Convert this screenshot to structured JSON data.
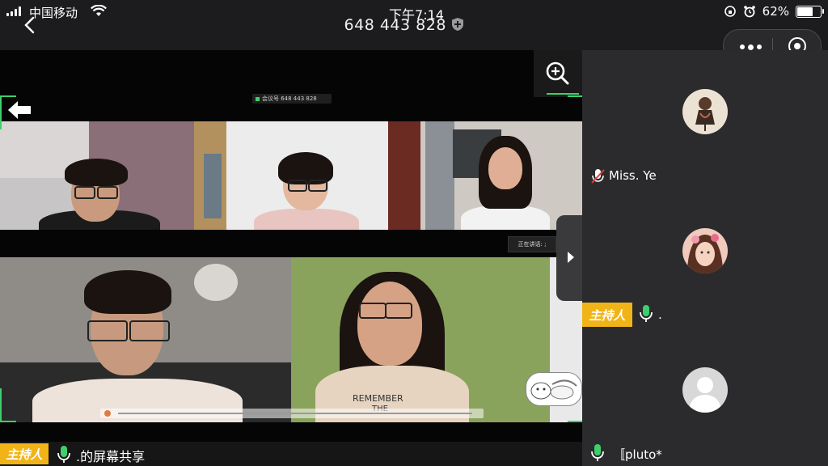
{
  "status_bar": {
    "carrier": "中国移动",
    "time": "下午7:14",
    "battery": "62%",
    "battery_level": 0.62
  },
  "header": {
    "meeting_id": "648 443 828"
  },
  "share": {
    "meeting_pill": "会议号 648 443 828",
    "speaking_label": "正在讲话: ;"
  },
  "bottom_bar": {
    "host_label": "主持人",
    "text": ".的屏幕共享"
  },
  "participants": [
    {
      "name": "Miss. Ye",
      "mic": "muted"
    },
    {
      "name": ".",
      "mic": "on",
      "host_label": "主持人"
    },
    {
      "name": "〚pluto*",
      "mic": "on"
    }
  ],
  "colors": {
    "accent_green": "#3ecf6c",
    "host_badge": "#f1b418",
    "panel_bg": "#2b2b2d"
  },
  "icons": [
    "signal-icon",
    "wifi-icon",
    "back-icon",
    "shield-icon",
    "alarm-icon",
    "battery-icon",
    "more-icon",
    "target-icon",
    "zoom-icon",
    "arrow-left-icon",
    "next-arrow-icon",
    "mic-icon",
    "mic-muted-icon"
  ]
}
